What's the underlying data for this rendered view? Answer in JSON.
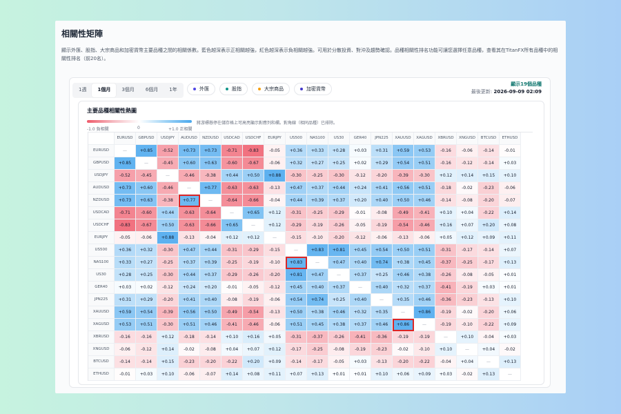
{
  "page": {
    "title": "相關性矩陣",
    "description": "顯示外匯、股指、大宗商品和加密貨幣主要品種之間的相關係數。藍色越深表示正相關越強，紅色越深表示負相關越強。可用於分散投資、對沖及趨勢確認。品種相關性排名功能可讓您選擇任意品種，查看其在TitanFX所有品種中的相關性排名（前20名）。"
  },
  "periods": [
    "1週",
    "1個月",
    "3個月",
    "6個月",
    "1年"
  ],
  "active_period": "1個月",
  "filters": [
    {
      "label": "外匯",
      "color": "#4f46e5"
    },
    {
      "label": "股指",
      "color": "#0d9488"
    },
    {
      "label": "大宗商品",
      "color": "#f59e0b"
    },
    {
      "label": "加密貨幣",
      "color": "#4338ca"
    }
  ],
  "status": {
    "count": "顯示19個品種",
    "updated_label": "最後更新:",
    "updated_value": "2026-09-09 02:09"
  },
  "heatmap": {
    "title": "主要品種相關性熱圖",
    "legend_neg": "-1.0 負相關",
    "legend_zero": "0",
    "legend_pos": "+1.0 正相關",
    "legend_note": "將游標懸停在儲存格上可高亮顯示對應列和欄。對角線（相同品種）已排除。",
    "colors": {
      "positive": "#4aa8ee",
      "negative": "#ef5a6a"
    }
  },
  "chart_data": {
    "type": "heatmap",
    "symbols": [
      "EURUSD",
      "GBPUSD",
      "USDJPY",
      "AUDUSD",
      "NZDUSD",
      "USDCAD",
      "USDCHF",
      "EURJPY",
      "US500",
      "NAS100",
      "US30",
      "GER40",
      "JPN225",
      "XAUUSD",
      "XAGUSD",
      "XBRUSD",
      "XNGUSD",
      "BTCUSD",
      "ETHUSD"
    ],
    "diagonal_label": "—",
    "matrix": [
      [
        null,
        0.85,
        -0.52,
        0.73,
        0.73,
        -0.71,
        -0.83,
        -0.05,
        0.36,
        0.33,
        0.28,
        0.03,
        0.31,
        0.59,
        0.53,
        -0.16,
        -0.06,
        -0.14,
        -0.01
      ],
      [
        0.85,
        null,
        -0.45,
        0.6,
        0.63,
        -0.6,
        -0.67,
        -0.06,
        0.32,
        0.27,
        0.25,
        0.02,
        0.29,
        0.54,
        0.51,
        -0.16,
        -0.12,
        -0.14,
        0.03
      ],
      [
        -0.52,
        -0.45,
        null,
        -0.46,
        -0.38,
        0.44,
        0.5,
        0.88,
        -0.3,
        -0.25,
        -0.3,
        -0.12,
        -0.2,
        -0.39,
        -0.3,
        0.12,
        0.14,
        0.15,
        0.1
      ],
      [
        0.73,
        0.6,
        -0.46,
        null,
        0.77,
        -0.63,
        -0.63,
        -0.13,
        0.47,
        0.37,
        0.44,
        0.24,
        0.41,
        0.56,
        0.51,
        -0.18,
        -0.02,
        -0.23,
        -0.06
      ],
      [
        0.73,
        0.63,
        -0.38,
        0.77,
        null,
        -0.64,
        -0.66,
        -0.04,
        0.44,
        0.39,
        0.37,
        0.2,
        0.4,
        0.5,
        0.46,
        -0.14,
        -0.08,
        -0.2,
        -0.07
      ],
      [
        -0.71,
        -0.6,
        0.44,
        -0.63,
        -0.64,
        null,
        0.65,
        0.12,
        -0.31,
        -0.25,
        -0.29,
        -0.01,
        -0.08,
        -0.49,
        -0.41,
        0.1,
        0.04,
        -0.22,
        0.14
      ],
      [
        -0.83,
        -0.67,
        0.5,
        -0.63,
        -0.66,
        0.65,
        null,
        0.12,
        -0.29,
        -0.19,
        -0.26,
        -0.05,
        -0.19,
        -0.54,
        -0.46,
        0.16,
        0.07,
        0.2,
        0.08
      ],
      [
        -0.05,
        -0.06,
        0.88,
        -0.13,
        -0.04,
        0.12,
        0.12,
        null,
        -0.15,
        -0.1,
        -0.2,
        -0.12,
        -0.06,
        -0.13,
        -0.06,
        0.05,
        0.12,
        0.09,
        0.11
      ],
      [
        0.36,
        0.32,
        -0.3,
        0.47,
        0.44,
        -0.31,
        -0.29,
        -0.15,
        null,
        0.83,
        0.81,
        0.45,
        0.54,
        0.5,
        0.51,
        -0.31,
        -0.17,
        -0.14,
        0.07
      ],
      [
        0.33,
        0.27,
        -0.25,
        0.37,
        0.39,
        -0.25,
        -0.19,
        -0.1,
        0.83,
        null,
        0.47,
        0.4,
        0.74,
        0.38,
        0.45,
        -0.37,
        -0.25,
        -0.17,
        0.13
      ],
      [
        0.28,
        0.25,
        -0.3,
        0.44,
        0.37,
        -0.29,
        -0.26,
        -0.2,
        0.81,
        0.47,
        null,
        0.37,
        0.25,
        0.46,
        0.38,
        -0.26,
        -0.08,
        -0.05,
        0.01
      ],
      [
        0.03,
        0.02,
        -0.12,
        0.24,
        0.2,
        -0.01,
        -0.05,
        -0.12,
        0.45,
        0.4,
        0.37,
        null,
        0.4,
        0.32,
        0.37,
        -0.41,
        -0.19,
        0.03,
        0.01
      ],
      [
        0.31,
        0.29,
        -0.2,
        0.41,
        0.4,
        -0.08,
        -0.19,
        -0.06,
        0.54,
        0.74,
        0.25,
        0.4,
        null,
        0.35,
        0.46,
        -0.36,
        -0.23,
        -0.13,
        0.1
      ],
      [
        0.59,
        0.54,
        -0.39,
        0.56,
        0.5,
        -0.49,
        -0.54,
        -0.13,
        0.5,
        0.38,
        0.46,
        0.32,
        0.35,
        null,
        0.86,
        -0.19,
        -0.02,
        -0.2,
        0.06
      ],
      [
        0.53,
        0.51,
        -0.3,
        0.51,
        0.46,
        -0.41,
        -0.46,
        -0.06,
        0.51,
        0.45,
        0.38,
        0.37,
        0.46,
        0.86,
        null,
        -0.19,
        -0.1,
        -0.22,
        0.09
      ],
      [
        -0.16,
        -0.16,
        0.12,
        -0.18,
        -0.14,
        0.1,
        0.16,
        0.05,
        -0.31,
        -0.37,
        -0.26,
        -0.41,
        -0.36,
        -0.19,
        -0.19,
        null,
        0.1,
        -0.04,
        0.03
      ],
      [
        -0.06,
        -0.12,
        0.14,
        -0.02,
        -0.08,
        0.04,
        0.07,
        0.12,
        -0.17,
        -0.25,
        -0.08,
        -0.19,
        -0.23,
        -0.02,
        -0.1,
        0.1,
        null,
        0.04,
        -0.02
      ],
      [
        -0.14,
        -0.14,
        0.15,
        -0.23,
        -0.2,
        -0.22,
        0.2,
        0.09,
        -0.14,
        -0.17,
        -0.05,
        0.03,
        -0.13,
        -0.2,
        -0.22,
        -0.04,
        0.04,
        null,
        0.13
      ],
      [
        -0.01,
        0.03,
        0.1,
        -0.06,
        -0.07,
        0.14,
        0.08,
        0.11,
        0.07,
        0.13,
        0.01,
        0.01,
        0.1,
        0.06,
        0.09,
        0.03,
        -0.02,
        0.13,
        null
      ]
    ],
    "highlighted": [
      [
        4,
        3
      ],
      [
        9,
        8
      ],
      [
        14,
        13
      ]
    ],
    "value_range": [
      -1,
      1
    ]
  }
}
